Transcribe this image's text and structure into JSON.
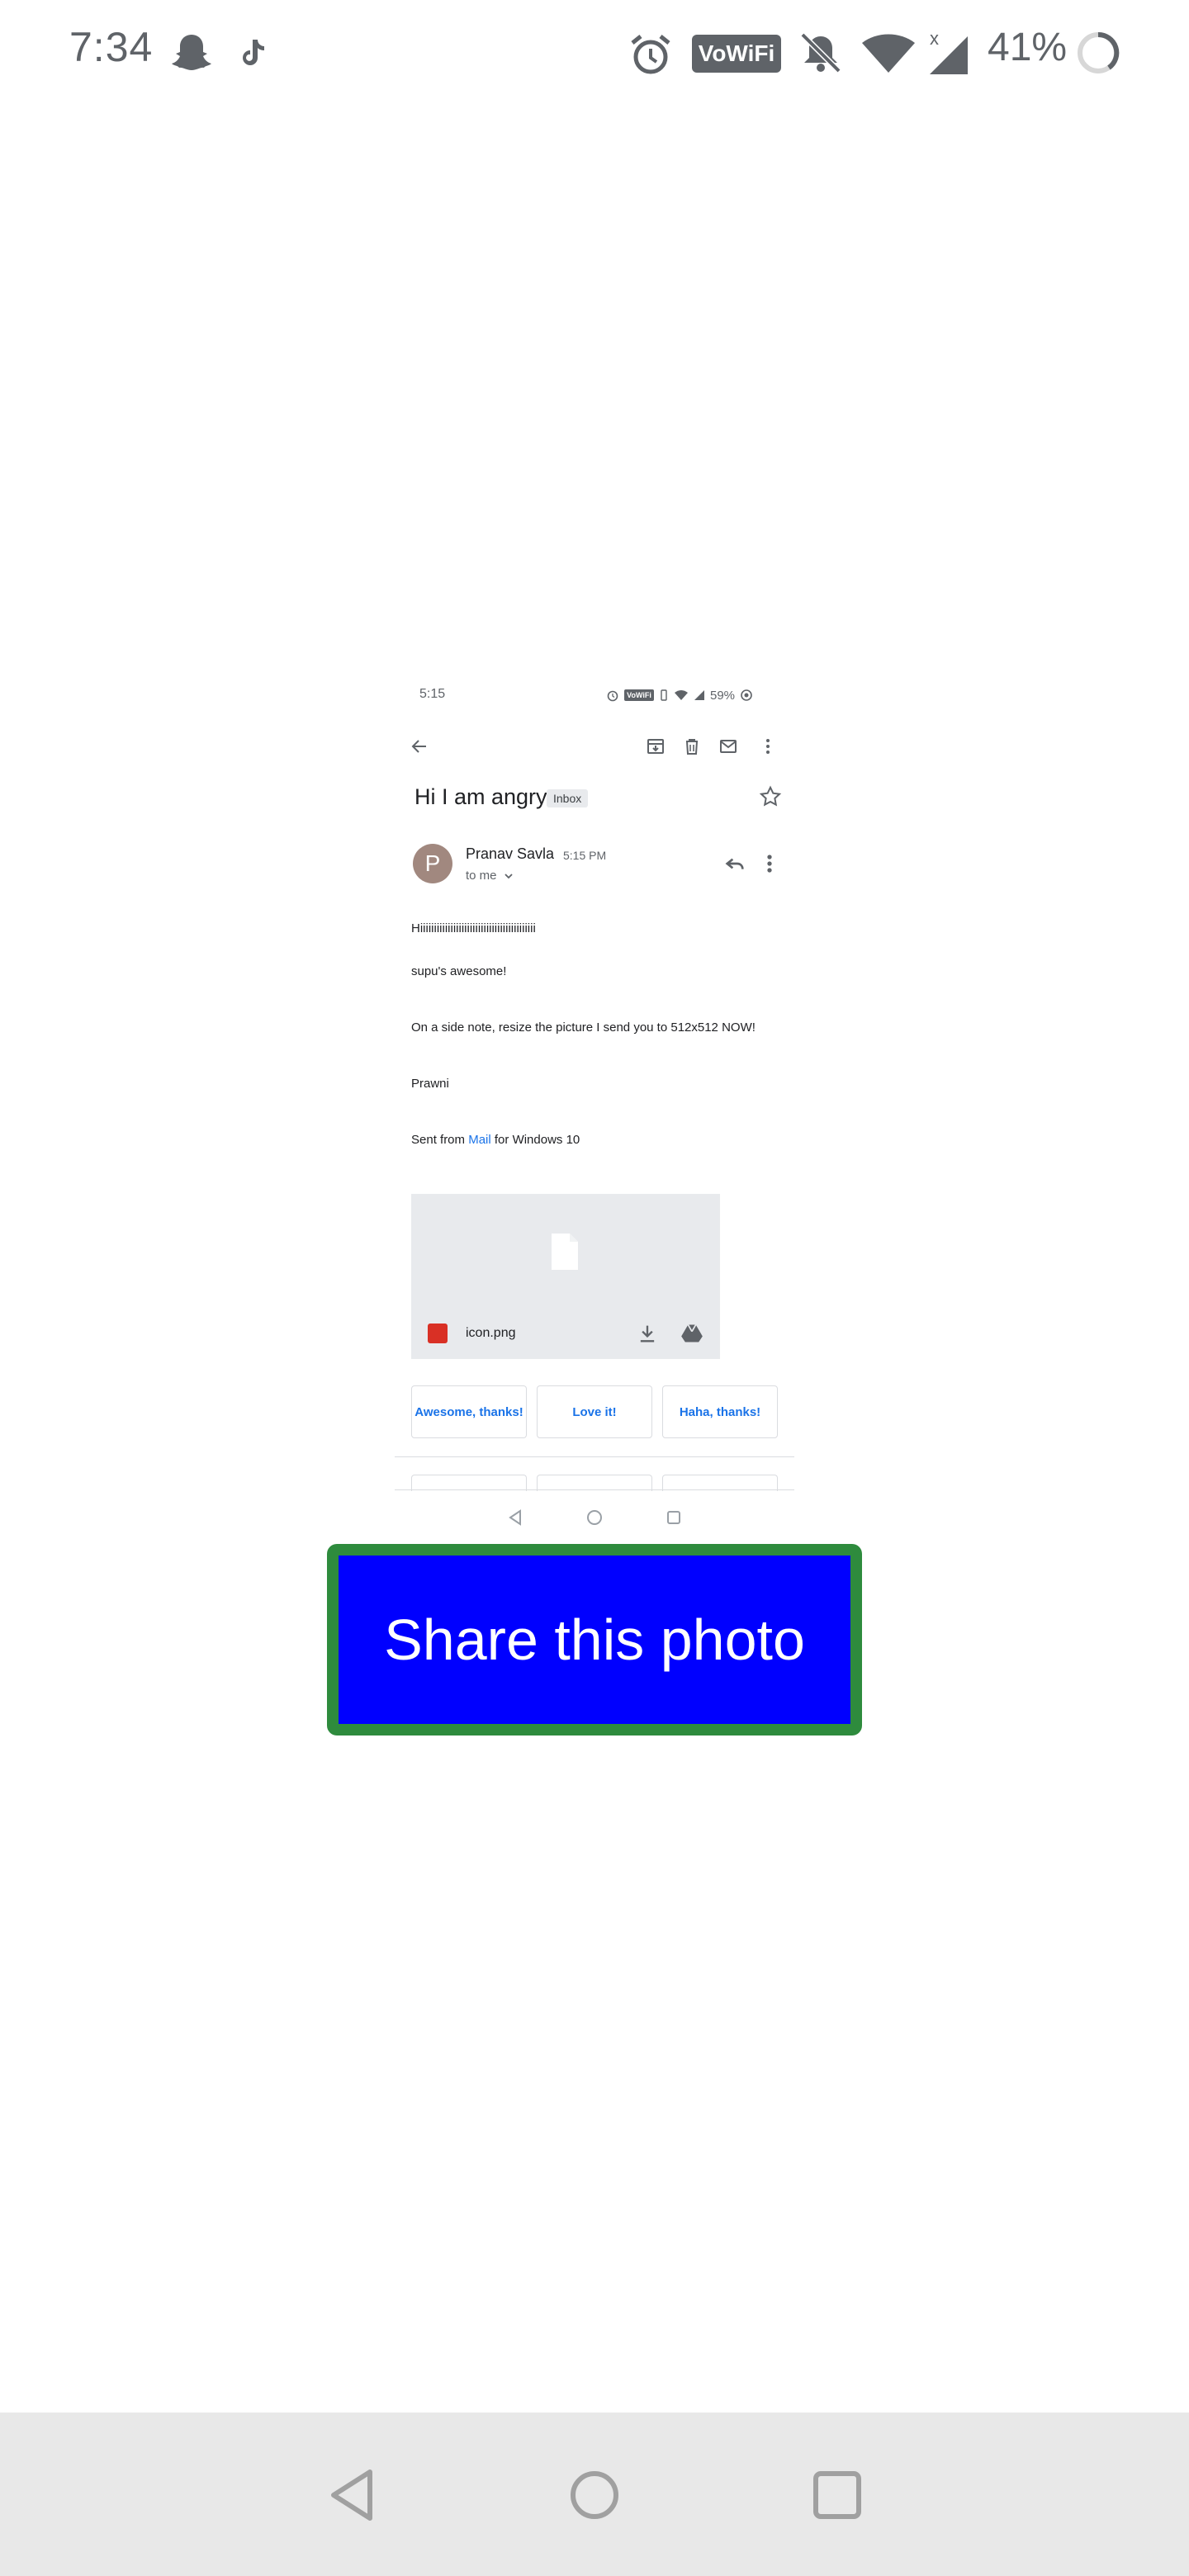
{
  "status_bar": {
    "time": "7:34",
    "battery": "41%",
    "vowifi": "VoWiFi",
    "icons": [
      "snapchat-icon",
      "tiktok-icon",
      "alarm-icon",
      "vowifi-icon",
      "bell-off-icon",
      "wifi-icon",
      "signal-icon",
      "battery-icon"
    ]
  },
  "email_screenshot": {
    "status_bar": {
      "time": "5:15",
      "vowifi": "VoWiFi",
      "battery": "59%"
    },
    "toolbar": {
      "icons": [
        "back-arrow-icon",
        "archive-icon",
        "delete-icon",
        "mark-unread-icon",
        "more-vert-icon"
      ]
    },
    "subject": "Hi I am angry",
    "label": "Inbox",
    "sender": {
      "avatar_letter": "P",
      "avatar_color": "#a1887f",
      "name": "Pranav Savla",
      "time": "5:15 PM",
      "recipient": "to me"
    },
    "body": {
      "greeting": "Hiiiiiiiiiiiiiiiiiiiiiiiiiiiiiiiiiiiiiiiiii",
      "line1": "supu's awesome!",
      "line2": "On a side note, resize the picture I send you to 512x512 NOW!",
      "signature": "Prawni",
      "sent_from_prefix": "Sent from",
      "sent_from_link": "Mail",
      "sent_from_suffix": "for Windows 10"
    },
    "attachment": {
      "filename": "icon.png"
    },
    "smart_replies": [
      "Awesome, thanks!",
      "Love it!",
      "Haha, thanks!"
    ]
  },
  "share_button": {
    "label": "Share this photo",
    "fill_color": "#0000ff",
    "border_color": "#2e8b3d"
  },
  "nav_bar": {
    "icons": [
      "back-icon",
      "home-icon",
      "recents-icon"
    ]
  }
}
